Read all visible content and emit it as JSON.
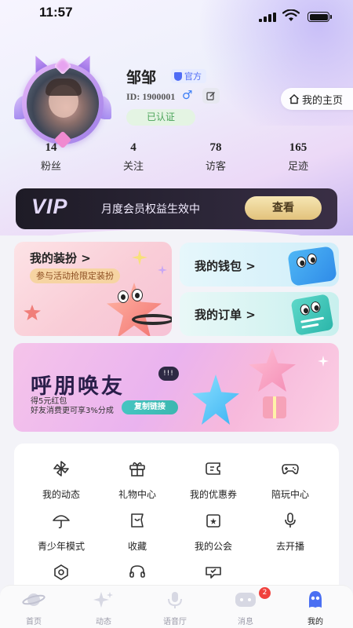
{
  "status_bar": {
    "time": "11:57"
  },
  "profile": {
    "name": "邹邹",
    "official_label": "官方",
    "user_id": "ID: 1900001",
    "gender_symbol": "♂",
    "verified_label": "已认证",
    "homepage_label": "我的主页"
  },
  "stats": [
    {
      "value": "14",
      "label": "粉丝"
    },
    {
      "value": "4",
      "label": "关注"
    },
    {
      "value": "78",
      "label": "访客"
    },
    {
      "value": "165",
      "label": "足迹"
    }
  ],
  "vip": {
    "logo": "VIP",
    "text": "月度会员权益生效中",
    "button_label": "查看"
  },
  "cards": {
    "dress": {
      "title": "我的装扮 >",
      "tag": "参与活动抢限定装扮"
    },
    "wallet": {
      "title": "我的钱包 >"
    },
    "orders": {
      "title": "我的订单 >"
    }
  },
  "banner": {
    "title": "呼朋唤友",
    "bubble": "!!!",
    "line1": "得5元红包",
    "line2": "好友消费更可享3%分成",
    "button_label": "复制链接"
  },
  "grid": [
    {
      "label": "我的动态",
      "icon": "pinwheel-icon"
    },
    {
      "label": "礼物中心",
      "icon": "gift-icon"
    },
    {
      "label": "我的优惠券",
      "icon": "coupon-icon"
    },
    {
      "label": "陪玩中心",
      "icon": "gamepad-icon"
    },
    {
      "label": "青少年模式",
      "icon": "umbrella-icon"
    },
    {
      "label": "收藏",
      "icon": "bookmark-icon"
    },
    {
      "label": "我的公会",
      "icon": "guild-icon"
    },
    {
      "label": "去开播",
      "icon": "microphone-icon"
    },
    {
      "label": "",
      "icon": "settings-icon"
    },
    {
      "label": "",
      "icon": "headset-icon"
    },
    {
      "label": "",
      "icon": "feedback-icon"
    }
  ],
  "nav": [
    {
      "label": "首页",
      "icon": "planet-icon"
    },
    {
      "label": "动态",
      "icon": "sparkle-icon"
    },
    {
      "label": "语音厅",
      "icon": "voice-room-icon"
    },
    {
      "label": "消息",
      "icon": "message-icon",
      "badge": "2"
    },
    {
      "label": "我的",
      "icon": "profile-icon"
    }
  ],
  "colors": {
    "accent": "#4f6cf5",
    "vip_gold": "#e2c27c",
    "verified_green": "#4ba45a",
    "badge_red": "#f0413d"
  }
}
